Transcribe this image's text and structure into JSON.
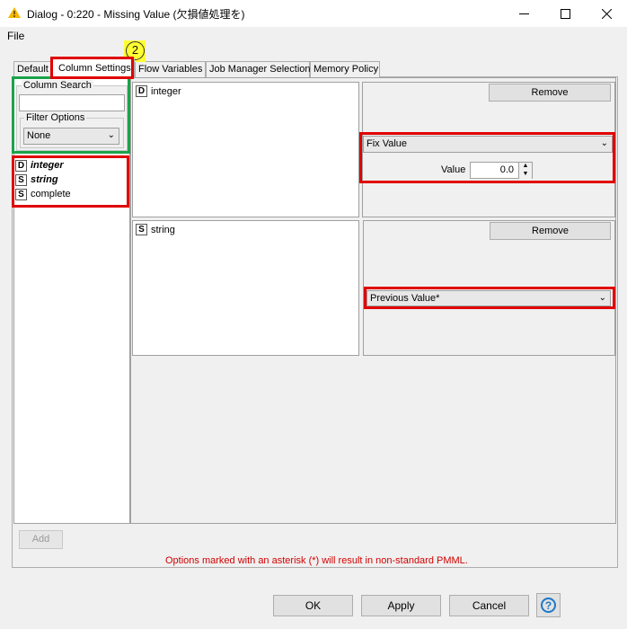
{
  "window": {
    "title": "Dialog - 0:220 - Missing Value (欠損値処理を)",
    "minimize_icon": "minimize-icon",
    "maximize_icon": "maximize-icon",
    "close_icon": "close-icon"
  },
  "menu": {
    "file": "File"
  },
  "annotation": {
    "step": "2"
  },
  "tabs": [
    {
      "label": "Default"
    },
    {
      "label": "Column Settings"
    },
    {
      "label": "Flow Variables"
    },
    {
      "label": "Job Manager Selection"
    },
    {
      "label": "Memory Policy"
    }
  ],
  "left": {
    "column_search_label": "Column Search",
    "search_value": "",
    "filter_options_label": "Filter Options",
    "filter_value": "None",
    "columns": [
      {
        "type": "D",
        "name": "integer"
      },
      {
        "type": "S",
        "name": "string"
      },
      {
        "type": "S",
        "name": "complete"
      }
    ],
    "add_label": "Add"
  },
  "settings": [
    {
      "type": "D",
      "column": "integer",
      "remove_label": "Remove",
      "strategy": "Fix Value",
      "value_label": "Value",
      "value": "0.0"
    },
    {
      "type": "S",
      "column": "string",
      "remove_label": "Remove",
      "strategy": "Previous Value*"
    }
  ],
  "note": "Options marked with an asterisk (*) will result in non-standard PMML.",
  "buttons": {
    "ok": "OK",
    "apply": "Apply",
    "cancel": "Cancel"
  },
  "colors": {
    "highlight_red": "#e00000",
    "highlight_green": "#1aa34a",
    "note_red": "#d20000",
    "badge_yellow": "#ffff33"
  }
}
